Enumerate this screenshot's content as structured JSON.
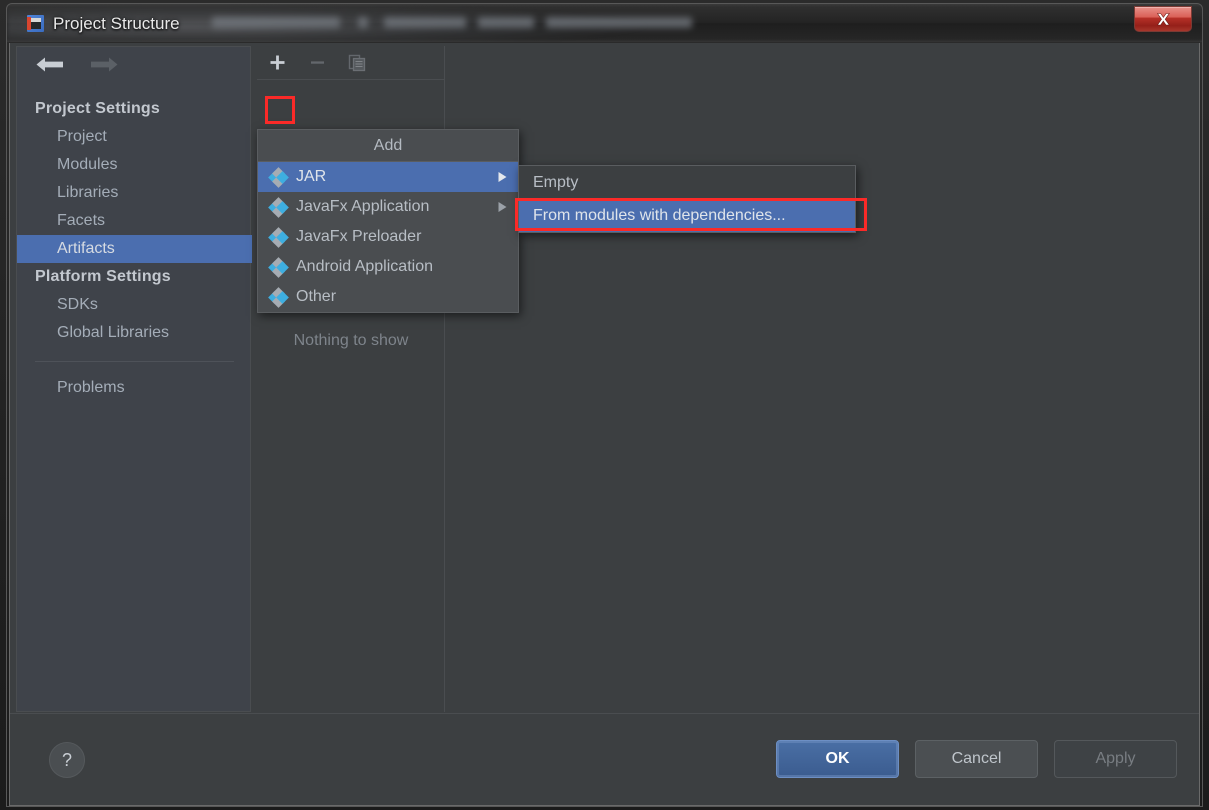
{
  "window": {
    "title": "Project Structure",
    "app_icon": "intellij-idea-icon",
    "close_label": "Close",
    "redacted_title_suffix": true
  },
  "sidebar": {
    "back_label": "Back",
    "forward_label": "Forward",
    "groups": [
      {
        "title": "Project Settings",
        "items": [
          {
            "label": "Project",
            "selected": false
          },
          {
            "label": "Modules",
            "selected": false
          },
          {
            "label": "Libraries",
            "selected": false
          },
          {
            "label": "Facets",
            "selected": false
          },
          {
            "label": "Artifacts",
            "selected": true
          }
        ]
      },
      {
        "title": "Platform Settings",
        "items": [
          {
            "label": "SDKs",
            "selected": false
          },
          {
            "label": "Global Libraries",
            "selected": false
          }
        ]
      }
    ],
    "extra_items": [
      {
        "label": "Problems",
        "selected": false
      }
    ]
  },
  "artifacts_panel": {
    "toolbar": {
      "add_label": "Add",
      "remove_label": "Remove",
      "copy_label": "Copy"
    },
    "empty_text": "Nothing to show"
  },
  "add_menu": {
    "title": "Add",
    "items": [
      {
        "label": "JAR",
        "icon": "artifact-icon",
        "has_submenu": true,
        "selected": true
      },
      {
        "label": "JavaFx Application",
        "icon": "artifact-icon",
        "has_submenu": true,
        "selected": false
      },
      {
        "label": "JavaFx Preloader",
        "icon": "artifact-icon",
        "has_submenu": false,
        "selected": false
      },
      {
        "label": "Android Application",
        "icon": "artifact-icon",
        "has_submenu": false,
        "selected": false
      },
      {
        "label": "Other",
        "icon": "artifact-icon",
        "has_submenu": false,
        "selected": false
      }
    ]
  },
  "sub_menu": {
    "items": [
      {
        "label": "Empty",
        "selected": false
      },
      {
        "label": "From modules with dependencies...",
        "selected": true
      }
    ]
  },
  "footer": {
    "help_label": "?",
    "buttons": [
      {
        "label": "OK",
        "style": "primary"
      },
      {
        "label": "Cancel",
        "style": "normal"
      },
      {
        "label": "Apply",
        "style": "disabled"
      }
    ]
  },
  "colors": {
    "dialog_bg": "#3c3f41",
    "sidebar_bg": "#3f434a",
    "selection_blue": "#4b6eaf",
    "menu_bg": "#4a4d50",
    "highlight_red": "#fb2a28",
    "icon_blue": "#3eaee0",
    "icon_gray": "#a6acb3",
    "text_primary": "#b8bec5",
    "close_red": "#b63028"
  }
}
